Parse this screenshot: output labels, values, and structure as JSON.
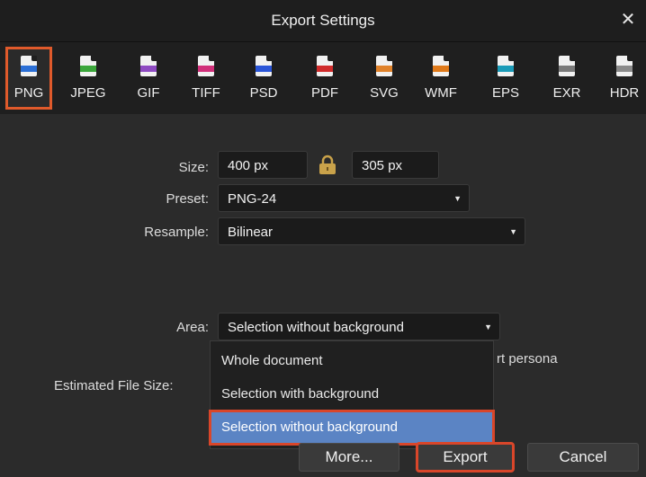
{
  "window": {
    "title": "Export Settings",
    "close_glyph": "✕"
  },
  "formats": [
    {
      "label": "PNG",
      "color": "#2b6fd6",
      "icon": "png-file-icon",
      "selected": true
    },
    {
      "label": "JPEG",
      "color": "#3aa63a",
      "icon": "jpeg-file-icon"
    },
    {
      "label": "GIF",
      "color": "#8e4ac2",
      "icon": "gif-file-icon"
    },
    {
      "label": "TIFF",
      "color": "#d12f7a",
      "icon": "tiff-file-icon"
    },
    {
      "label": "PSD",
      "color": "#2a55d8",
      "icon": "psd-file-icon"
    },
    {
      "label": "PDF",
      "color": "#d02b2b",
      "icon": "pdf-file-icon"
    },
    {
      "label": "SVG",
      "color": "#e0822a",
      "icon": "svg-file-icon"
    },
    {
      "label": "WMF",
      "color": "#e07a1a",
      "icon": "wmf-file-icon"
    },
    {
      "label": "EPS",
      "color": "#1a9bb8",
      "icon": "eps-file-icon"
    },
    {
      "label": "EXR",
      "color": "#7a7a7a",
      "icon": "exr-file-icon"
    },
    {
      "label": "HDR",
      "color": "#8a8a8a",
      "icon": "hdr-file-icon"
    }
  ],
  "form": {
    "size_label": "Size:",
    "width_value": "400 px",
    "height_value": "305 px",
    "preset_label": "Preset:",
    "preset_value": "PNG-24",
    "resample_label": "Resample:",
    "resample_value": "Bilinear",
    "area_label": "Area:",
    "area_value": "Selection without background",
    "estimated_label": "Estimated File Size:",
    "partial_text": "rt persona"
  },
  "area_menu": {
    "options": [
      "Whole document",
      "Selection with background",
      "Selection without background"
    ],
    "highlighted_index": 2
  },
  "buttons": {
    "more": "More...",
    "export": "Export",
    "cancel": "Cancel"
  },
  "colors": {
    "accent": "#5b84c4",
    "highlight_outline": "#d9462a"
  }
}
